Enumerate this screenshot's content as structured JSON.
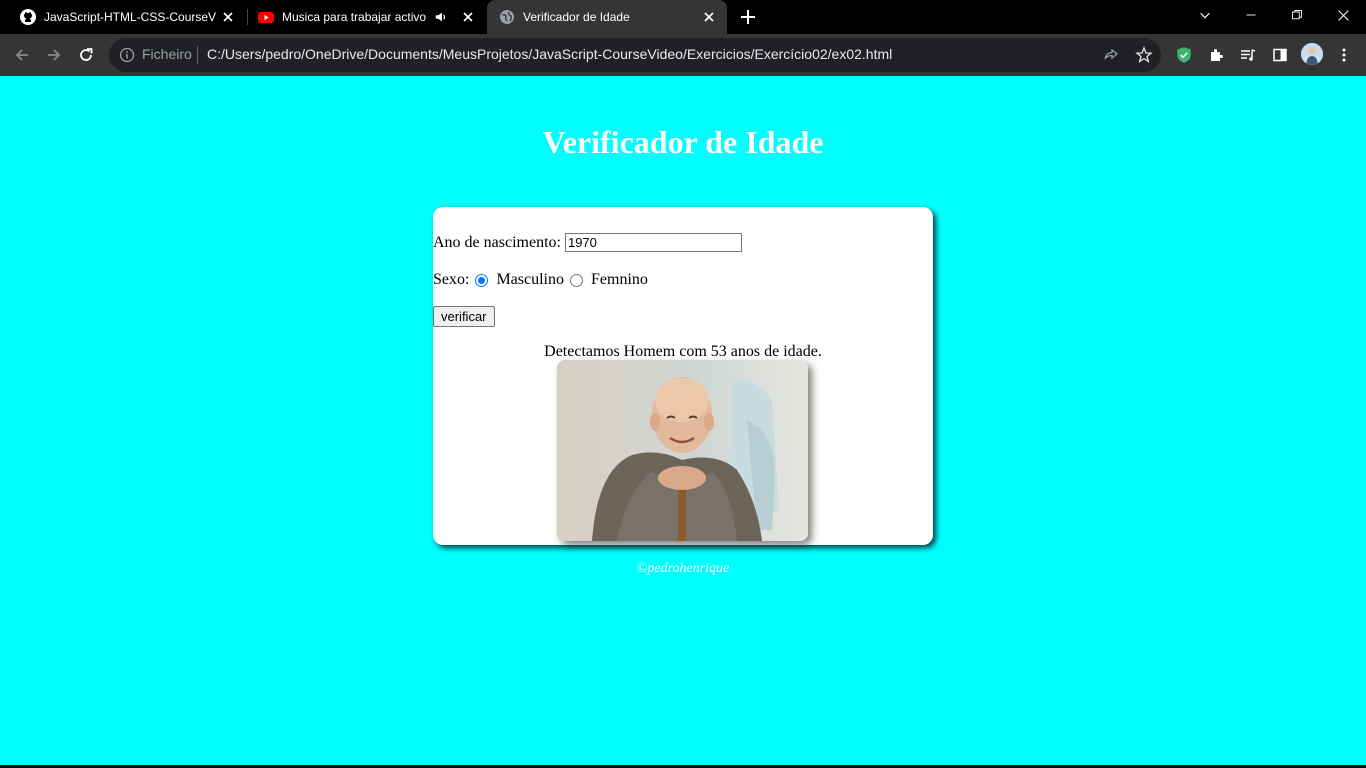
{
  "tabs": [
    {
      "title": "JavaScript-HTML-CSS-CourseVic",
      "icon": "github-icon"
    },
    {
      "title": "Musica para trabajar activo y",
      "icon": "youtube-icon",
      "audio_icon": "speaker-icon"
    },
    {
      "title": "Verificador de Idade",
      "icon": "globe-icon"
    }
  ],
  "toolbar": {
    "scheme": "Ficheiro",
    "url": "C:/Users/pedro/OneDrive/Documents/MeusProjetos/JavaScript-CourseVideo/Exercicios/Exercício02/ex02.html"
  },
  "page": {
    "title": "Verificador de Idade",
    "year_label": "Ano de nascimento:",
    "year_value": "1970",
    "sex_label": "Sexo:",
    "sex_options": [
      {
        "label": "Masculino",
        "checked": true
      },
      {
        "label": "Femnino",
        "checked": false
      }
    ],
    "check_button": "verificar",
    "result": "Detectamos Homem com 53 anos de idade.",
    "footer": "©pedrohenrique"
  },
  "colors": {
    "background": "#00ffff",
    "accent_radio": "#0075ff"
  }
}
